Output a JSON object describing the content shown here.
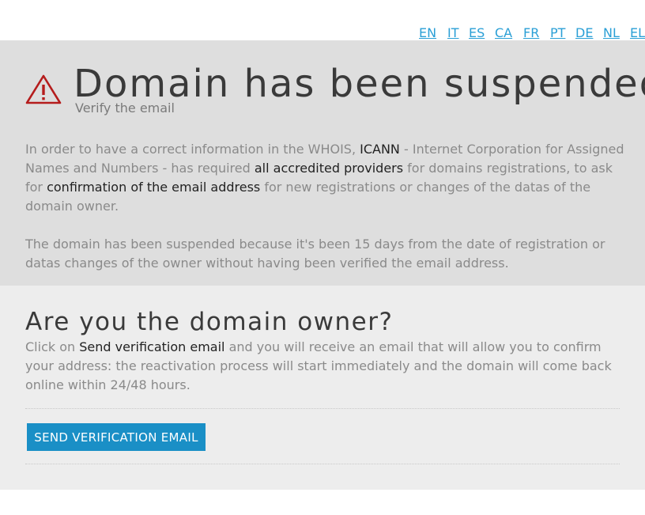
{
  "languages": [
    "EN",
    "IT",
    "ES",
    "CA",
    "FR",
    "PT",
    "DE",
    "NL",
    "EL"
  ],
  "header": {
    "title": "Domain has been suspended",
    "subtitle": "Verify the email",
    "warning_icon_color": "#b51c1c"
  },
  "info": {
    "p1_t1": "In order to have a correct information in the WHOIS, ",
    "p1_b1": "ICANN",
    "p1_t2": " - Internet Corporation for Assigned Names and Numbers - has required ",
    "p1_b2": "all accredited providers",
    "p1_t3": " for domains registrations, to ask for ",
    "p1_b3": "confirmation of the email address",
    "p1_t4": " for new registrations or changes of the datas of the domain owner.",
    "p2": "The domain has been suspended because it's been 15 days from the date of registration or datas changes of the owner without having been verified the email address."
  },
  "owner": {
    "heading": "Are you the domain owner?",
    "p_t1": "Click on ",
    "p_b1": "Send verification email",
    "p_t2": " and you will receive an email that will allow you to confirm your address: the reactivation process will start immediately and the domain will come back online within 24/48 hours.",
    "button_label": "SEND VERIFICATION EMAIL"
  },
  "colors": {
    "link": "#2a9fd6",
    "button": "#1a8fc6",
    "top_bg": "#dedede",
    "bottom_bg": "#ededed"
  }
}
